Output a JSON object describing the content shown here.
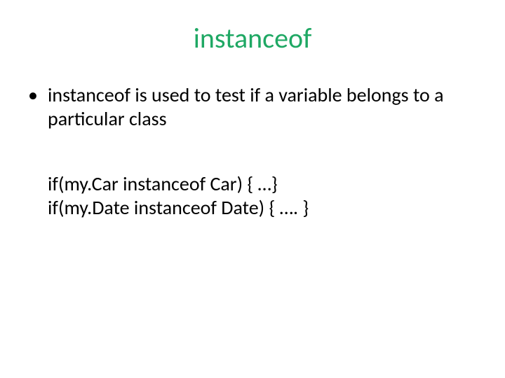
{
  "title": {
    "text": "instanceof",
    "color": "#1fa864"
  },
  "bullet": "instanceof is used to test if a variable belongs to a particular class",
  "code": {
    "line1": "if(my.Car instanceof Car) { …}",
    "line2": "if(my.Date instanceof  Date) { …. }"
  }
}
